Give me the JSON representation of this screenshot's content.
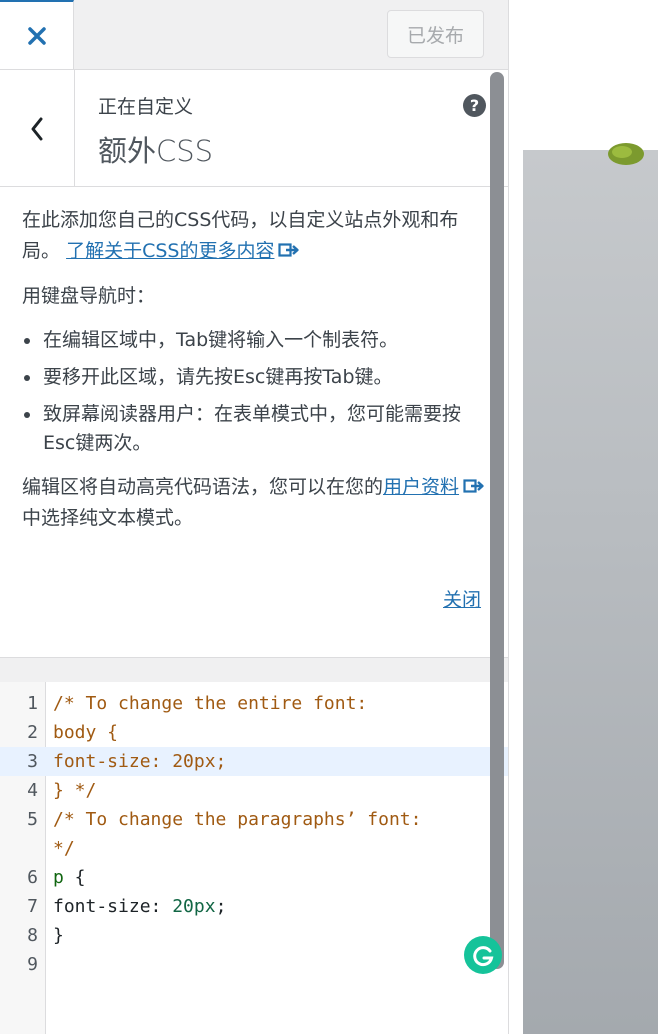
{
  "header": {
    "close_icon": "close-x-icon",
    "publish_label": "已发布"
  },
  "section": {
    "back_icon": "chevron-left-icon",
    "customizing_label": "正在自定义",
    "title": "额外CSS",
    "help_icon": "help-question-icon",
    "help_glyph": "?"
  },
  "description": {
    "intro": "在此添加您自己的CSS代码，以自定义站点外观和布局。",
    "learn_more_link": "了解关于CSS的更多内容",
    "keyboard_heading": "用键盘导航时：",
    "tips": [
      "在编辑区域中，Tab键将输入一个制表符。",
      "要移开此区域，请先按Esc键再按Tab键。",
      "致屏幕阅读器用户：在表单模式中，您可能需要按Esc键两次。"
    ],
    "highlight_text": "编辑区将自动高亮代码语法，您可以在您的",
    "profile_link": "用户资料",
    "highlight_text_end": "中选择纯文本模式。",
    "close_link": "关闭",
    "external_icon": "external-link-icon"
  },
  "editor": {
    "line_numbers": [
      "1",
      "2",
      "3",
      "4",
      "5",
      "",
      "6",
      "7",
      "8",
      "9"
    ],
    "line1": "/* To change the entire font:",
    "line2": "body {",
    "line3": "font-size: 20px;",
    "line4": "} */",
    "line5a": "/* To change the paragraphs’ font:",
    "line5b": "*/",
    "line6_selector": "p",
    "line6_brace": " {",
    "line7_prop": "font-size: ",
    "line7_value": "20px",
    "line7_end": ";",
    "line8": "}",
    "line9": "",
    "active_line": "3"
  },
  "colors": {
    "accent": "#2271b1",
    "comment": "#a05a12",
    "tag": "#116611",
    "number": "#116644",
    "active_line_bg": "#e8f2ff",
    "grammarly": "#15c39a"
  },
  "widgets": {
    "grammarly_icon": "grammarly-icon",
    "preview_leaf_icon": "leaf-image"
  }
}
